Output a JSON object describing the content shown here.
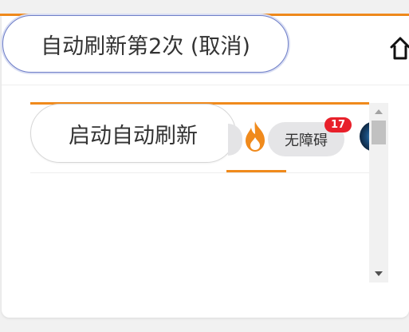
{
  "header": {
    "refresh_button_label": "自动刷新第2次 (取消)",
    "home_icon": "home-icon"
  },
  "toolbar": {
    "start_refresh_label": "启动自动刷新",
    "hot_icon": "flame-icon",
    "accessibility_label": "无障碍",
    "notification_count": "17"
  },
  "colors": {
    "accent": "#f08a1c",
    "badge": "#e8202a",
    "pill_border": "#6f7fc8"
  }
}
